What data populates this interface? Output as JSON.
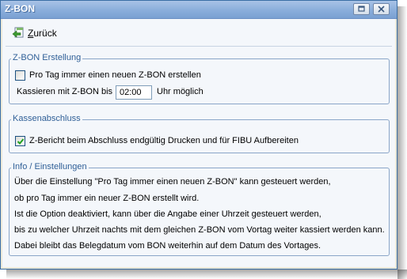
{
  "window": {
    "title": "Z-BON"
  },
  "toolbar": {
    "back_accel": "Z",
    "back_rest": "urück"
  },
  "zbon": {
    "group_title": "Z-BON Erstellung",
    "daily_checkbox_label": "Pro Tag immer einen neuen Z-BON erstellen",
    "daily_checked": false,
    "time_label_before": "Kassieren mit Z-BON bis",
    "time_value": "02:00",
    "time_label_after": "Uhr möglich"
  },
  "kasse": {
    "group_title": "Kassenabschluss",
    "print_checkbox_label": "Z-Bericht beim Abschluss endgültig Drucken und für FIBU Aufbereiten",
    "print_checked": true
  },
  "info": {
    "group_title": "Info / Einstellungen",
    "lines": [
      "Über die Einstellung \"Pro Tag immer einen neuen Z-BON\" kann gesteuert werden,",
      "ob pro Tag immer ein neuer Z-BON erstellt wird.",
      "Ist die Option deaktiviert, kann über die Angabe einer Uhrzeit gesteuert werden,",
      "bis zu welcher Uhrzeit nachts mit dem gleichen Z-BON vom Vortag weiter kassiert werden kann.",
      "Dabei bleibt das Belegdatum vom BON weiterhin auf dem Datum des Vortages."
    ]
  },
  "colors": {
    "titlebar": "#8cafdc",
    "group_border": "#8aa5c8",
    "legend_text": "#2f5f97"
  },
  "icons": {
    "back": "back-arrow-icon",
    "restore": "restore-icon",
    "close": "close-icon",
    "check": "checkmark-icon"
  }
}
